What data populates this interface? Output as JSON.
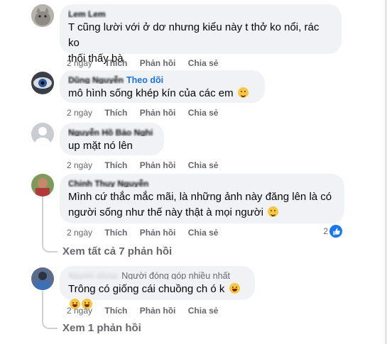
{
  "comments": [
    {
      "author": "Lem Lem",
      "badge": "",
      "follow": "",
      "text_lines": [
        "T cũng lười với ở dơ nhưng kiểu này t thở ko nổi, rác ko",
        "thối thấy bà"
      ],
      "emojis": 0,
      "time": "2 ngày",
      "like": "Thích",
      "reply": "Phản hồi",
      "share": "Chia sẻ",
      "reactions": ""
    },
    {
      "author": "Dũng Nguyễn",
      "badge": "",
      "follow": "Theo dõi",
      "text_lines": [
        "mô hình sống khép kín của các em"
      ],
      "emojis": 1,
      "time": "2 ngày",
      "like": "Thích",
      "reply": "Phản hồi",
      "share": "Chia sẻ",
      "reactions": ""
    },
    {
      "author": "Nguyễn Hồ Bảo Nghi",
      "badge": "",
      "follow": "",
      "text_lines": [
        "up mặt nó lên"
      ],
      "emojis": 0,
      "time": "2 ngày",
      "like": "Thích",
      "reply": "Phản hồi",
      "share": "Chia sẻ",
      "reactions": ""
    },
    {
      "author": "Chinh Thuy Nguyễn",
      "badge": "",
      "follow": "",
      "text_lines": [
        "Mình cứ thắc mắc mãi, là những ảnh này đăng lên là có",
        "người sống như thế này thật à mọi người"
      ],
      "emojis": 1,
      "time": "2 ngày",
      "like": "Thích",
      "reply": "Phản hồi",
      "share": "Chia sẻ",
      "reactions": "2"
    },
    {
      "author": "Người dùng",
      "badge": "Người đóng góp nhiều nhất",
      "follow": "",
      "text_lines": [
        "Trông có giống cái chuồng ch ó k"
      ],
      "emojis": 3,
      "time": "2 ngày",
      "like": "Thích",
      "reply": "Phản hồi",
      "share": "Chia sẻ",
      "reactions": ""
    }
  ],
  "view_more_1": "Xem tất cả 7 phản hồi",
  "view_more_2": "Xem 1 phản hồi",
  "colors": {
    "bubble": "#f0f2f5",
    "link": "#1a73e8",
    "meta": "#65676b",
    "like": "#1877f2"
  }
}
